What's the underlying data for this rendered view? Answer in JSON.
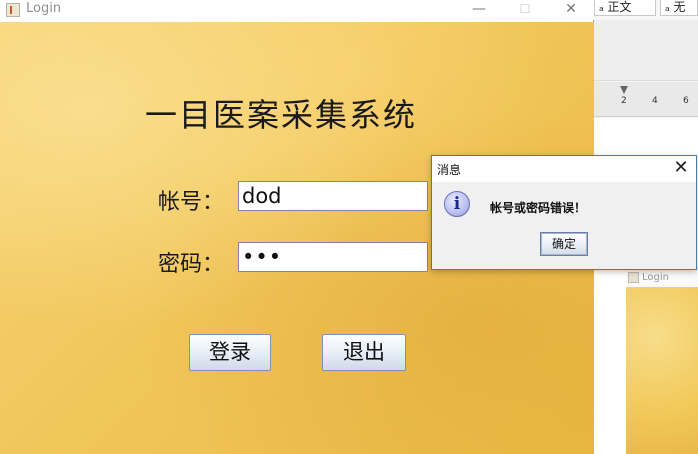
{
  "login_window": {
    "title": "Login",
    "minimize_glyph": "—",
    "maximize_glyph": "☐",
    "close_glyph": "✕",
    "system_title": "一目医案采集系统",
    "account_label": "帐号：",
    "account_value": "dod",
    "password_label": "密码：",
    "password_value": "•••",
    "login_button": "登录",
    "exit_button": "退出"
  },
  "message_dialog": {
    "title": "消息",
    "close_glyph": "✕",
    "icon": "info-icon",
    "icon_glyph": "i",
    "message": "帐号或密码错误！",
    "ok_button": "确定"
  },
  "background_app": {
    "style_buttons": [
      "正文",
      "无"
    ],
    "style_button_prefix": "ₐ",
    "ruler_numbers": [
      "2",
      "4",
      "6"
    ]
  },
  "background_login_thumb": {
    "title": "Login"
  }
}
